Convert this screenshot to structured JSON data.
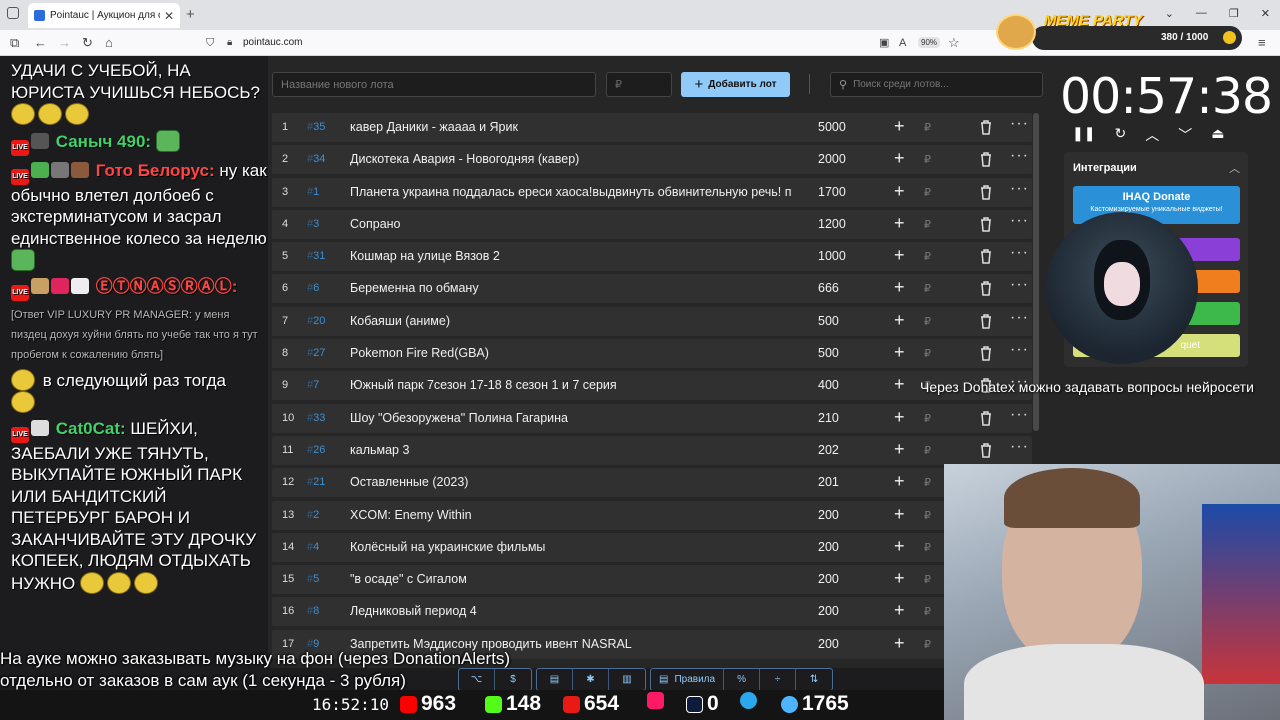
{
  "browser": {
    "tab_title": "Pointauc | Аукцион для стрим",
    "tab_close": "✕",
    "new_tab": "+",
    "url": "pointauc.com",
    "zoom": "90%"
  },
  "chat": {
    "messages": [
      {
        "text": "УДАЧИ С УЧЕБОЙ, НА ЮРИСТА УЧИШЬСЯ НЕБОСЬ?"
      },
      {
        "name": "Саныч 490:",
        "name_color": "#3fd26a",
        "text": ""
      },
      {
        "name": "Гото Белорус:",
        "name_color": "#ff4545",
        "text": "ну как обычно влетел долбоеб с экстерминатусом и засрал единственное колесо за неделю"
      },
      {
        "name": "ⒺⓉⓃⒶⓈⓇⒶⓁ:",
        "name_color": "#ff4545",
        "text": ""
      },
      {
        "text": "[Ответ VIP LUXURY PR MANAGER: у меня пиздец дохуя хуйни блять по учебе так что я тут пробегом к сожалению блять]"
      },
      {
        "text": "в следующий раз тогда"
      },
      {
        "name": "Cat0Cat:",
        "name_color": "#3fd26a",
        "text": "ШЕЙХИ, ЗАЕБАЛИ УЖЕ ТЯНУТЬ, ВЫКУПАЙТЕ ЮЖНЫЙ ПАРК ИЛИ БАНДИТСКИЙ ПЕТЕРБУРГ БАРОН И ЗАКАНЧИВАЙТЕ ЭТУ ДРОЧКУ КОПЕЕК, ЛЮДЯМ ОТДЫХАТЬ НУЖНО"
      }
    ],
    "badge_live": "LIVE"
  },
  "form": {
    "lot_name_placeholder": "Название нового лота",
    "price_placeholder": "₽",
    "add_button_label": "Добавить лот",
    "search_placeholder": "Поиск среди лотов..."
  },
  "lots": [
    {
      "index": "1",
      "fast_id": "35",
      "name": "кавер Даники - жаааа и Ярик",
      "amount": "5000"
    },
    {
      "index": "2",
      "fast_id": "34",
      "name": "Дискотека Авария - Новогодняя (кавер)",
      "amount": "2000"
    },
    {
      "index": "3",
      "fast_id": "1",
      "name": "Планета украина поддалась ереси хаоса!выдвинуть обвинительную речь! пс",
      "amount": "1700"
    },
    {
      "index": "4",
      "fast_id": "3",
      "name": "Сопрано",
      "amount": "1200"
    },
    {
      "index": "5",
      "fast_id": "31",
      "name": "Кошмар на улице Вязов 2",
      "amount": "1000"
    },
    {
      "index": "6",
      "fast_id": "6",
      "name": "Беременна по обману",
      "amount": "666"
    },
    {
      "index": "7",
      "fast_id": "20",
      "name": "Кобаяши (аниме)",
      "amount": "500"
    },
    {
      "index": "8",
      "fast_id": "27",
      "name": "Pokemon Fire Red(GBA)",
      "amount": "500"
    },
    {
      "index": "9",
      "fast_id": "7",
      "name": "Южный парк 7сезон 17-18 8 сезон 1 и 7 серия",
      "amount": "400"
    },
    {
      "index": "10",
      "fast_id": "33",
      "name": "Шоу \"Обезоружена\" Полина Гагарина",
      "amount": "210"
    },
    {
      "index": "11",
      "fast_id": "26",
      "name": "кальмар 3",
      "amount": "202"
    },
    {
      "index": "12",
      "fast_id": "21",
      "name": "Оставленные (2023)",
      "amount": "201"
    },
    {
      "index": "13",
      "fast_id": "2",
      "name": "XCOM: Enemy Within",
      "amount": "200"
    },
    {
      "index": "14",
      "fast_id": "4",
      "name": "Колёсный на украинские фильмы",
      "amount": "200"
    },
    {
      "index": "15",
      "fast_id": "5",
      "name": "\"в осаде\" с Сигалом",
      "amount": "200"
    },
    {
      "index": "16",
      "fast_id": "8",
      "name": "Ледниковый период 4",
      "amount": "200"
    },
    {
      "index": "17",
      "fast_id": "9",
      "name": "Запретить Мэддисону проводить ивент NASRAL",
      "amount": "200"
    }
  ],
  "lot_hash": "#",
  "lot_rub": "₽",
  "timer": {
    "value": "00:57:38"
  },
  "integrations": {
    "title": "Интеграции",
    "ihaq_label": "IHAQ Donate",
    "ihaq_sub": "Кастомизируемые уникальные виджеты!",
    "last_label": "quet"
  },
  "stream_caption": "Через Donatex можно задавать вопросы нейросети",
  "bottom_caption": {
    "line1": "На ауке можно заказывать музыку на фон (через DonationAlerts)",
    "line2": "отдельно от заказов в сам аук (1 секунда - 3 рубля)"
  },
  "app_toolbar": {
    "rules_label": "Правила",
    "percent": "%"
  },
  "meme_party": {
    "title": "MEME PARTY",
    "counter": "380 / 1000"
  },
  "stats": {
    "time": "16:52:10",
    "youtube": "963",
    "kick": "148",
    "live": "654",
    "vkplay": "",
    "rutube": "0",
    "telegram": "",
    "total": "1765"
  },
  "colors": {
    "accent": "#90caf9",
    "fast_id": "#3e8ed0",
    "timer": "#ffffff"
  }
}
